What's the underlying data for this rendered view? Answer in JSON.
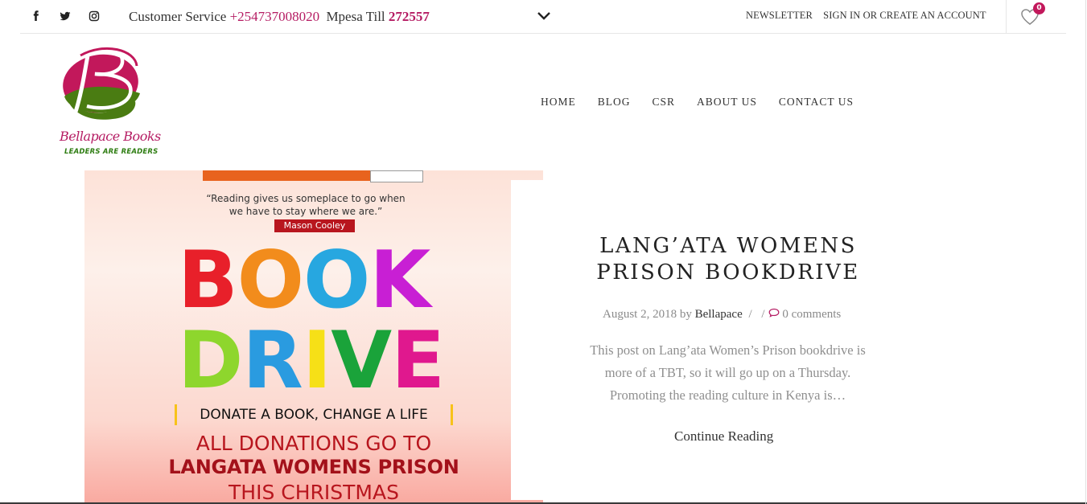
{
  "topbar": {
    "social": [
      {
        "icon": "facebook-icon",
        "glyph": "f"
      },
      {
        "icon": "twitter-icon",
        "glyph": "🐦"
      },
      {
        "icon": "instagram-icon",
        "glyph": "◎"
      }
    ],
    "service_label": "Customer Service",
    "service_phone": "+254737008020",
    "till_label": "Mpesa Till",
    "till_number": "272557",
    "newsletter": "NEWSLETTER",
    "signin": "SIGN IN OR CREATE AN ACCOUNT",
    "wishlist_count": "0"
  },
  "logo": {
    "name": "Bellapace Books",
    "tagline": "LEADERS ARE READERS",
    "colors": {
      "magenta": "#c2185b",
      "green": "#4a7c12"
    }
  },
  "nav": [
    "HOME",
    "BLOG",
    "CSR",
    "ABOUT US",
    "CONTACT US"
  ],
  "poster": {
    "quote": "“Reading gives us someplace to go when we have to stay where we are.”",
    "author": "Mason Cooley",
    "word1": [
      "B",
      "O",
      "O",
      "K"
    ],
    "word1_colors": [
      "#e8202a",
      "#f28c1c",
      "#27a7e0",
      "#c81fd4"
    ],
    "word2": [
      "D",
      "R",
      "I",
      "V",
      "E"
    ],
    "word2_colors": [
      "#8ed62d",
      "#2a9be0",
      "#f6e017",
      "#1aa33a",
      "#e0188e"
    ],
    "donate": "DONATE A BOOK, CHANGE A LIFE",
    "all_donations": "ALL DONATIONS GO TO",
    "langata": "LANGATA WOMENS PRISON",
    "christmas": "THIS CHRISTMAS"
  },
  "post": {
    "title": "LANG’ATA WOMENS PRISON BOOKDRIVE",
    "date": "August 2, 2018",
    "by_label": "by",
    "author": "Bellapace",
    "separator": "/",
    "comments": "0 comments",
    "excerpt": "This post on Lang’ata Women’s Prison bookdrive is more of a TBT, so it will go up on a Thursday. Promoting the reading culture in Kenya is…",
    "continue": "Continue Reading"
  }
}
